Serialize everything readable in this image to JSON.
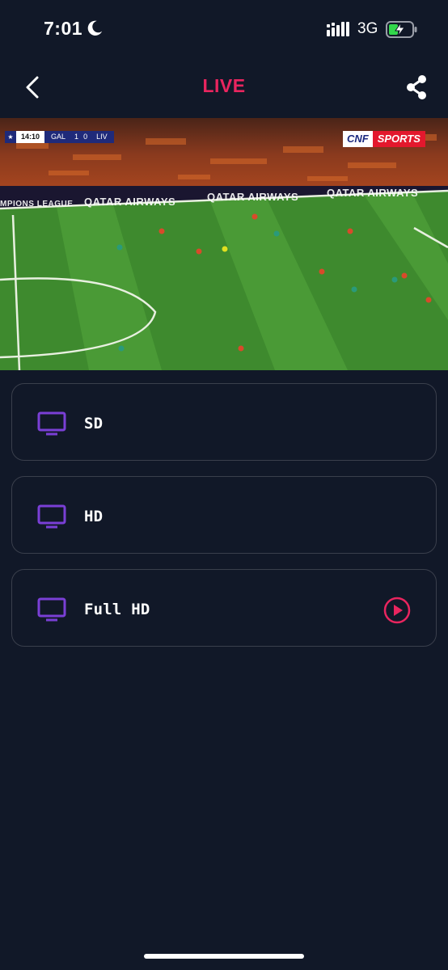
{
  "status_bar": {
    "time": "7:01",
    "network": "3G",
    "icons": [
      "moon-icon",
      "signal-icon",
      "battery-charging-icon"
    ]
  },
  "nav": {
    "title": "LIVE",
    "back_icon": "chevron-left-icon",
    "share_icon": "share-icon",
    "title_color": "#e9255f"
  },
  "video": {
    "scoreboard": {
      "clock": "14:10",
      "home": "GAL",
      "home_score": "1",
      "away_score": "0",
      "away": "LIV"
    },
    "channel_logo": {
      "left": "CNF",
      "right": "SPORTS"
    },
    "boards": [
      "MPIONS LEAGUE",
      "QATAR AIRWAYS",
      "QATAR AIRWAYS",
      "QATAR AIRWAYS"
    ]
  },
  "quality_options": [
    {
      "label": "SD",
      "icon": "tv-icon",
      "playing": false
    },
    {
      "label": "HD",
      "icon": "tv-icon",
      "playing": false
    },
    {
      "label": "Full HD",
      "icon": "tv-icon",
      "playing": true
    }
  ],
  "colors": {
    "background": "#111828",
    "accent": "#e9255f",
    "icon_purple": "#7a3fd6",
    "card_border": "#3a3f4c"
  }
}
